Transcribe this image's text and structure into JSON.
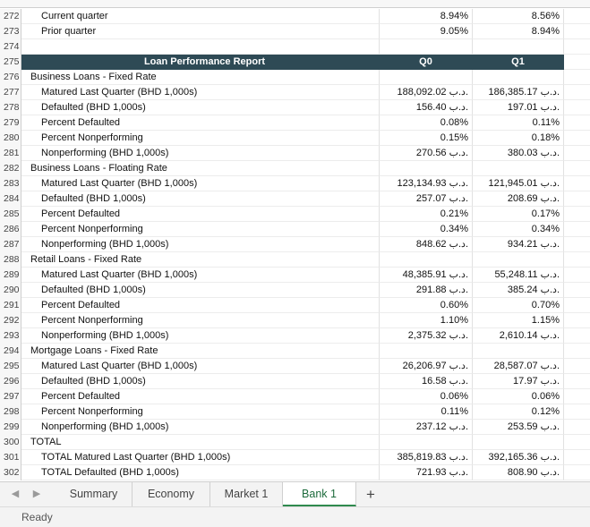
{
  "currency_prefix": "د.ب.",
  "rows": [
    {
      "num": "272",
      "label": "Current quarter",
      "level": 1,
      "q0": "8.94%",
      "q1": "8.56%"
    },
    {
      "num": "273",
      "label": "Prior quarter",
      "level": 1,
      "q0": "9.05%",
      "q1": "8.94%"
    },
    {
      "num": "274",
      "label": "",
      "level": 0,
      "q0": "",
      "q1": ""
    },
    {
      "num": "275",
      "label": "Loan Performance Report",
      "level": 0,
      "header": true,
      "q0": "Q0",
      "q1": "Q1"
    },
    {
      "num": "276",
      "label": "Business Loans - Fixed Rate",
      "level": 0,
      "q0": "",
      "q1": ""
    },
    {
      "num": "277",
      "label": "Matured Last Quarter (BHD 1,000s)",
      "level": 1,
      "q0": "188,092.02",
      "q1": "186,385.17",
      "cur": true
    },
    {
      "num": "278",
      "label": "Defaulted (BHD 1,000s)",
      "level": 1,
      "q0": "156.40",
      "q1": "197.01",
      "cur": true
    },
    {
      "num": "279",
      "label": "Percent Defaulted",
      "level": 1,
      "q0": "0.08%",
      "q1": "0.11%"
    },
    {
      "num": "280",
      "label": "Percent Nonperforming",
      "level": 1,
      "q0": "0.15%",
      "q1": "0.18%"
    },
    {
      "num": "281",
      "label": "Nonperforming (BHD 1,000s)",
      "level": 1,
      "q0": "270.56",
      "q1": "380.03",
      "cur": true
    },
    {
      "num": "282",
      "label": "Business Loans - Floating Rate",
      "level": 0,
      "q0": "",
      "q1": ""
    },
    {
      "num": "283",
      "label": "Matured Last Quarter (BHD 1,000s)",
      "level": 1,
      "q0": "123,134.93",
      "q1": "121,945.01",
      "cur": true
    },
    {
      "num": "284",
      "label": "Defaulted (BHD 1,000s)",
      "level": 1,
      "q0": "257.07",
      "q1": "208.69",
      "cur": true
    },
    {
      "num": "285",
      "label": "Percent Defaulted",
      "level": 1,
      "q0": "0.21%",
      "q1": "0.17%"
    },
    {
      "num": "286",
      "label": "Percent Nonperforming",
      "level": 1,
      "q0": "0.34%",
      "q1": "0.34%"
    },
    {
      "num": "287",
      "label": "Nonperforming (BHD 1,000s)",
      "level": 1,
      "q0": "848.62",
      "q1": "934.21",
      "cur": true
    },
    {
      "num": "288",
      "label": "Retail Loans - Fixed Rate",
      "level": 0,
      "q0": "",
      "q1": ""
    },
    {
      "num": "289",
      "label": "Matured Last Quarter (BHD 1,000s)",
      "level": 1,
      "q0": "48,385.91",
      "q1": "55,248.11",
      "cur": true
    },
    {
      "num": "290",
      "label": "Defaulted (BHD 1,000s)",
      "level": 1,
      "q0": "291.88",
      "q1": "385.24",
      "cur": true
    },
    {
      "num": "291",
      "label": "Percent Defaulted",
      "level": 1,
      "q0": "0.60%",
      "q1": "0.70%"
    },
    {
      "num": "292",
      "label": "Percent Nonperforming",
      "level": 1,
      "q0": "1.10%",
      "q1": "1.15%"
    },
    {
      "num": "293",
      "label": "Nonperforming (BHD 1,000s)",
      "level": 1,
      "q0": "2,375.32",
      "q1": "2,610.14",
      "cur": true
    },
    {
      "num": "294",
      "label": "Mortgage Loans - Fixed Rate",
      "level": 0,
      "q0": "",
      "q1": ""
    },
    {
      "num": "295",
      "label": "Matured Last Quarter (BHD 1,000s)",
      "level": 1,
      "q0": "26,206.97",
      "q1": "28,587.07",
      "cur": true
    },
    {
      "num": "296",
      "label": "Defaulted (BHD 1,000s)",
      "level": 1,
      "q0": "16.58",
      "q1": "17.97",
      "cur": true
    },
    {
      "num": "297",
      "label": "Percent Defaulted",
      "level": 1,
      "q0": "0.06%",
      "q1": "0.06%"
    },
    {
      "num": "298",
      "label": "Percent Nonperforming",
      "level": 1,
      "q0": "0.11%",
      "q1": "0.12%"
    },
    {
      "num": "299",
      "label": "Nonperforming (BHD 1,000s)",
      "level": 1,
      "q0": "237.12",
      "q1": "253.59",
      "cur": true
    },
    {
      "num": "300",
      "label": "TOTAL",
      "level": 0,
      "q0": "",
      "q1": ""
    },
    {
      "num": "301",
      "label": "TOTAL Matured Last Quarter (BHD 1,000s)",
      "level": 1,
      "q0": "385,819.83",
      "q1": "392,165.36",
      "cur": true
    },
    {
      "num": "302",
      "label": "TOTAL Defaulted (BHD 1,000s)",
      "level": 1,
      "q0": "721.93",
      "q1": "808.90",
      "cur": true
    }
  ],
  "tabs": [
    {
      "label": "Summary",
      "active": false
    },
    {
      "label": "Economy",
      "active": false
    },
    {
      "label": "Market 1",
      "active": false
    },
    {
      "label": "Bank 1",
      "active": true
    }
  ],
  "add_sheet_label": "+",
  "status": "Ready",
  "icons": {
    "prev": "triangle-left-icon",
    "next": "triangle-right-icon",
    "add": "plus-icon"
  },
  "colors": {
    "header_bg": "#2e4a55",
    "active_tab_text": "#1d6b3c"
  }
}
